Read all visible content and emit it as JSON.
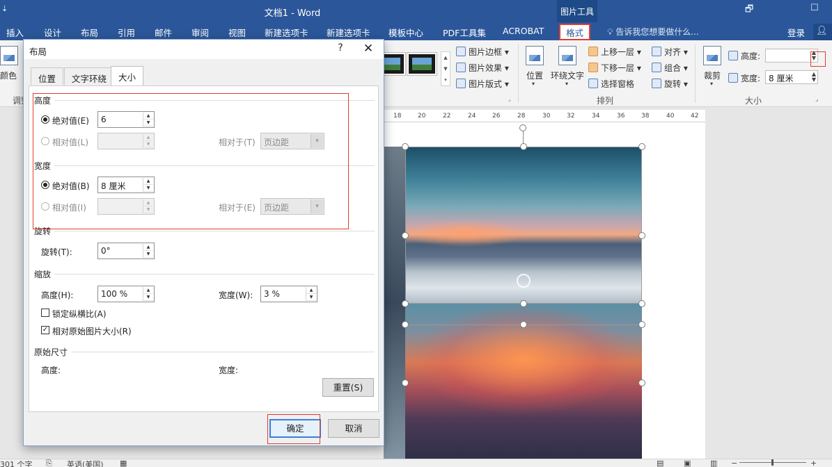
{
  "window": {
    "title": "文档1 - Word",
    "quick_access": "⇣",
    "context_tab_group": "图片工具",
    "controls": [
      "🗗",
      "☐"
    ]
  },
  "ribbon_tabs": [
    "插入",
    "设计",
    "布局",
    "引用",
    "邮件",
    "审阅",
    "视图",
    "新建选项卡",
    "新建选项卡",
    "模板中心",
    "PDF工具集",
    "ACROBAT",
    "格式"
  ],
  "active_tab": "格式",
  "tell_me": "告诉我您想要做什么...",
  "login": "登录",
  "share_icon": "person-icon",
  "ribbon": {
    "adjust": {
      "color_label": "颜色",
      "group_label": "调整"
    },
    "picture_styles": {
      "border": "图片边框",
      "effects": "图片效果",
      "layout": "图片版式"
    },
    "arrange": {
      "position": "位置",
      "wrap_text": "环绕文字",
      "bring_forward": "上移一层",
      "send_backward": "下移一层",
      "selection_pane": "选择窗格",
      "align": "对齐",
      "group": "组合",
      "rotate": "旋转",
      "group_label": "排列"
    },
    "size": {
      "crop": "裁剪",
      "height_label": "高度:",
      "height_value": "",
      "width_label": "宽度:",
      "width_value": "8 厘米",
      "group_label": "大小"
    }
  },
  "ruler_marks": [
    "18",
    "20",
    "22",
    "24",
    "26",
    "28",
    "30",
    "32",
    "34",
    "36",
    "38",
    "40",
    "42"
  ],
  "status": {
    "word_count": "301 个字",
    "language": "英语(美国)"
  },
  "dialog": {
    "title": "布局",
    "help": "?",
    "close": "✕",
    "tabs": [
      "位置",
      "文字环绕",
      "大小"
    ],
    "active_tab": "大小",
    "height_section": {
      "title": "高度",
      "absolute_label": "绝对值(E)",
      "absolute_value": "6",
      "relative_label": "相对值(L)",
      "relative_value": "",
      "relative_to_label": "相对于(T)",
      "relative_to_value": "页边距"
    },
    "width_section": {
      "title": "宽度",
      "absolute_label": "绝对值(B)",
      "absolute_value": "8 厘米",
      "relative_label": "相对值(I)",
      "relative_value": "",
      "relative_to_label": "相对于(E)",
      "relative_to_value": "页边距"
    },
    "rotation_section": {
      "title": "旋转",
      "rotation_label": "旋转(T):",
      "rotation_value": "0°"
    },
    "scale_section": {
      "title": "缩放",
      "height_label": "高度(H):",
      "height_value": "100 %",
      "width_label": "宽度(W):",
      "width_value": "3 %",
      "lock_aspect_label": "锁定纵横比(A)",
      "lock_aspect_checked": false,
      "relative_original_label": "相对原始图片大小(R)",
      "relative_original_checked": true
    },
    "original_size_section": {
      "title": "原始尺寸",
      "height_label": "高度:",
      "width_label": "宽度:"
    },
    "reset_button": "重置(S)",
    "ok_button": "确定",
    "cancel_button": "取消"
  },
  "colors": {
    "title_bar": "#2b579a",
    "highlight_box": "#e03c31",
    "primary_button_border": "#3c7fd5"
  }
}
